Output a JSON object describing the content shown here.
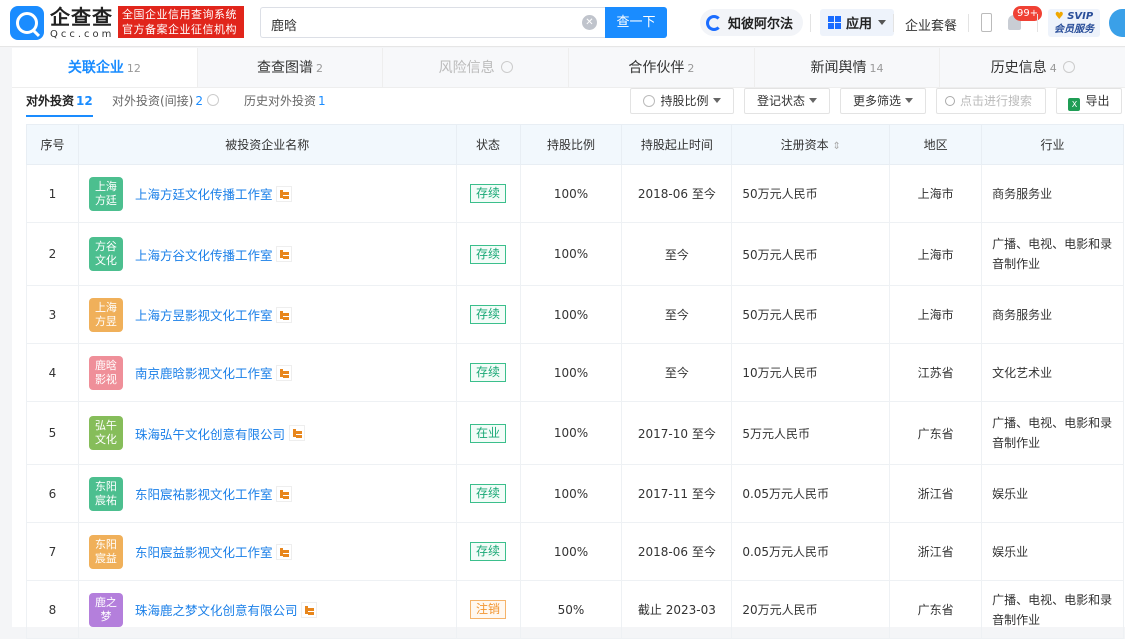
{
  "header": {
    "brand_cn": "企查查",
    "brand_en": "Qcc.com",
    "badge_line1": "全国企业信用查询系统",
    "badge_line2": "官方备案企业征信机构",
    "search_value": "鹿晗",
    "search_button": "查一下",
    "zhibi_label": "知彼阿尔法",
    "app_label": "应用",
    "package_label": "企业套餐",
    "notification_count": "99+",
    "svip_line1": "SVIP",
    "svip_line2": "会员服务"
  },
  "tabs": [
    {
      "label": "关联企业",
      "count": "12",
      "active": true
    },
    {
      "label": "查查图谱",
      "count": "2"
    },
    {
      "label": "风险信息",
      "count": "",
      "disabled": true
    },
    {
      "label": "合作伙伴",
      "count": "2"
    },
    {
      "label": "新闻舆情",
      "count": "14"
    },
    {
      "label": "历史信息",
      "count": "4"
    }
  ],
  "subtabs": [
    {
      "label": "对外投资",
      "count": "12"
    },
    {
      "label": "对外投资(间接)",
      "count": "2"
    },
    {
      "label": "历史对外投资",
      "count": "1"
    }
  ],
  "filters": {
    "ratio": "持股比例",
    "status": "登记状态",
    "more": "更多筛选",
    "search_placeholder": "点击进行搜索",
    "export": "导出"
  },
  "table": {
    "headers": [
      "序号",
      "被投资企业名称",
      "状态",
      "持股比例",
      "持股起止时间",
      "注册资本",
      "地区",
      "行业"
    ],
    "sort_icon": "⇕",
    "rows": [
      {
        "no": "1",
        "logo": [
          "上海",
          "方廷"
        ],
        "logo_color": "#4cbf8f",
        "name": "上海方廷文化传播工作室",
        "status": "存续",
        "ratio": "100%",
        "period": "2018-06 至今",
        "capital": "50万元人民币",
        "region": "上海市",
        "industry": "商务服务业"
      },
      {
        "no": "2",
        "logo": [
          "方谷",
          "文化"
        ],
        "logo_color": "#4cbf8f",
        "name": "上海方谷文化传播工作室",
        "status": "存续",
        "ratio": "100%",
        "period": "至今",
        "capital": "50万元人民币",
        "region": "上海市",
        "industry": "广播、电视、电影和录音制作业"
      },
      {
        "no": "3",
        "logo": [
          "上海",
          "方昱"
        ],
        "logo_color": "#f0b05a",
        "name": "上海方昱影视文化工作室",
        "status": "存续",
        "ratio": "100%",
        "period": "至今",
        "capital": "50万元人民币",
        "region": "上海市",
        "industry": "商务服务业"
      },
      {
        "no": "4",
        "logo": [
          "鹿晗",
          "影视"
        ],
        "logo_color": "#ef8f99",
        "name": "南京鹿晗影视文化工作室",
        "status": "存续",
        "ratio": "100%",
        "period": "至今",
        "capital": "10万元人民币",
        "region": "江苏省",
        "industry": "文化艺术业"
      },
      {
        "no": "5",
        "logo": [
          "弘午",
          "文化"
        ],
        "logo_color": "#86bd5a",
        "name": "珠海弘午文化创意有限公司",
        "status": "在业",
        "ratio": "100%",
        "period": "2017-10 至今",
        "capital": "5万元人民币",
        "region": "广东省",
        "industry": "广播、电视、电影和录音制作业"
      },
      {
        "no": "6",
        "logo": [
          "东阳",
          "宸祐"
        ],
        "logo_color": "#4cbf8f",
        "name": "东阳宸祐影视文化工作室",
        "status": "存续",
        "ratio": "100%",
        "period": "2017-11 至今",
        "capital": "0.05万元人民币",
        "region": "浙江省",
        "industry": "娱乐业"
      },
      {
        "no": "7",
        "logo": [
          "东阳",
          "宸益"
        ],
        "logo_color": "#f0b05a",
        "name": "东阳宸益影视文化工作室",
        "status": "存续",
        "ratio": "100%",
        "period": "2018-06 至今",
        "capital": "0.05万元人民币",
        "region": "浙江省",
        "industry": "娱乐业"
      },
      {
        "no": "8",
        "logo": [
          "鹿之",
          "梦"
        ],
        "logo_color": "#b47fdc",
        "name": "珠海鹿之梦文化创意有限公司",
        "status": "注销",
        "ratio": "50%",
        "period": "截止 2023-03",
        "capital": "20万元人民币",
        "region": "广东省",
        "industry": "广播、电视、电影和录音制作业"
      }
    ]
  }
}
